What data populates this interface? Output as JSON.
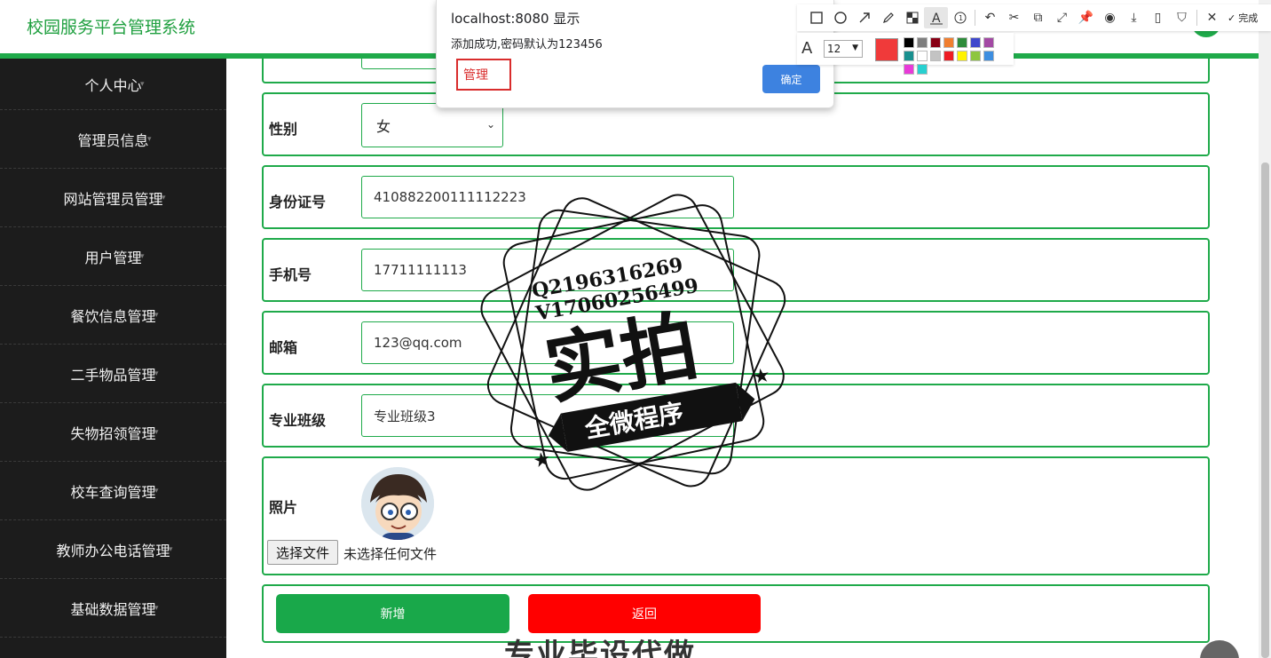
{
  "header": {
    "title": "校园服务平台管理系统"
  },
  "sidebar": {
    "items": [
      {
        "label": "个人中心"
      },
      {
        "label": "管理员信息"
      },
      {
        "label": "网站管理员管理"
      },
      {
        "label": "用户管理"
      },
      {
        "label": "餐饮信息管理"
      },
      {
        "label": "二手物品管理"
      },
      {
        "label": "失物招领管理"
      },
      {
        "label": "校车查询管理"
      },
      {
        "label": "教师办公电话管理"
      },
      {
        "label": "基础数据管理"
      }
    ]
  },
  "form": {
    "gender": {
      "label": "性别",
      "value": "女"
    },
    "id_card": {
      "label": "身份证号",
      "value": "410882200111112223"
    },
    "phone": {
      "label": "手机号",
      "value": "17711111113"
    },
    "email": {
      "label": "邮箱",
      "value": "123@qq.com"
    },
    "major_class": {
      "label": "专业班级",
      "value": "专业班级3"
    },
    "photo": {
      "label": "照片",
      "file_button": "选择文件",
      "file_status": "未选择任何文件"
    },
    "add_button": "新增",
    "back_button": "返回"
  },
  "dialog": {
    "title": "localhost:8080 显示",
    "message": "添加成功,密码默认为123456",
    "annotation_text": "管理",
    "ok_button": "确定"
  },
  "screenshot_toolbar": {
    "done_label": "完成",
    "font_size": "12",
    "current_color": "#f03a3a",
    "swatches": [
      "#000000",
      "#7f7f7f",
      "#880015",
      "#f07f30",
      "#2e8b3a",
      "#3f48cc",
      "#a349a4",
      "#19908f",
      "#ffffff",
      "#c3c3c3",
      "#ed1c24",
      "#fff200",
      "#8ec63f",
      "#3d8ee0",
      "#e83ad8",
      "#28d0d0"
    ]
  },
  "watermark": {
    "line1": "Q2196316269",
    "line2": "V17060256499",
    "main": "实拍",
    "banner": "全微程序",
    "bottom": "专业毕设代做"
  },
  "colors": {
    "accent": "#1faa4a",
    "danger": "#ff0000",
    "sidebar_bg": "#1c1c1c"
  }
}
